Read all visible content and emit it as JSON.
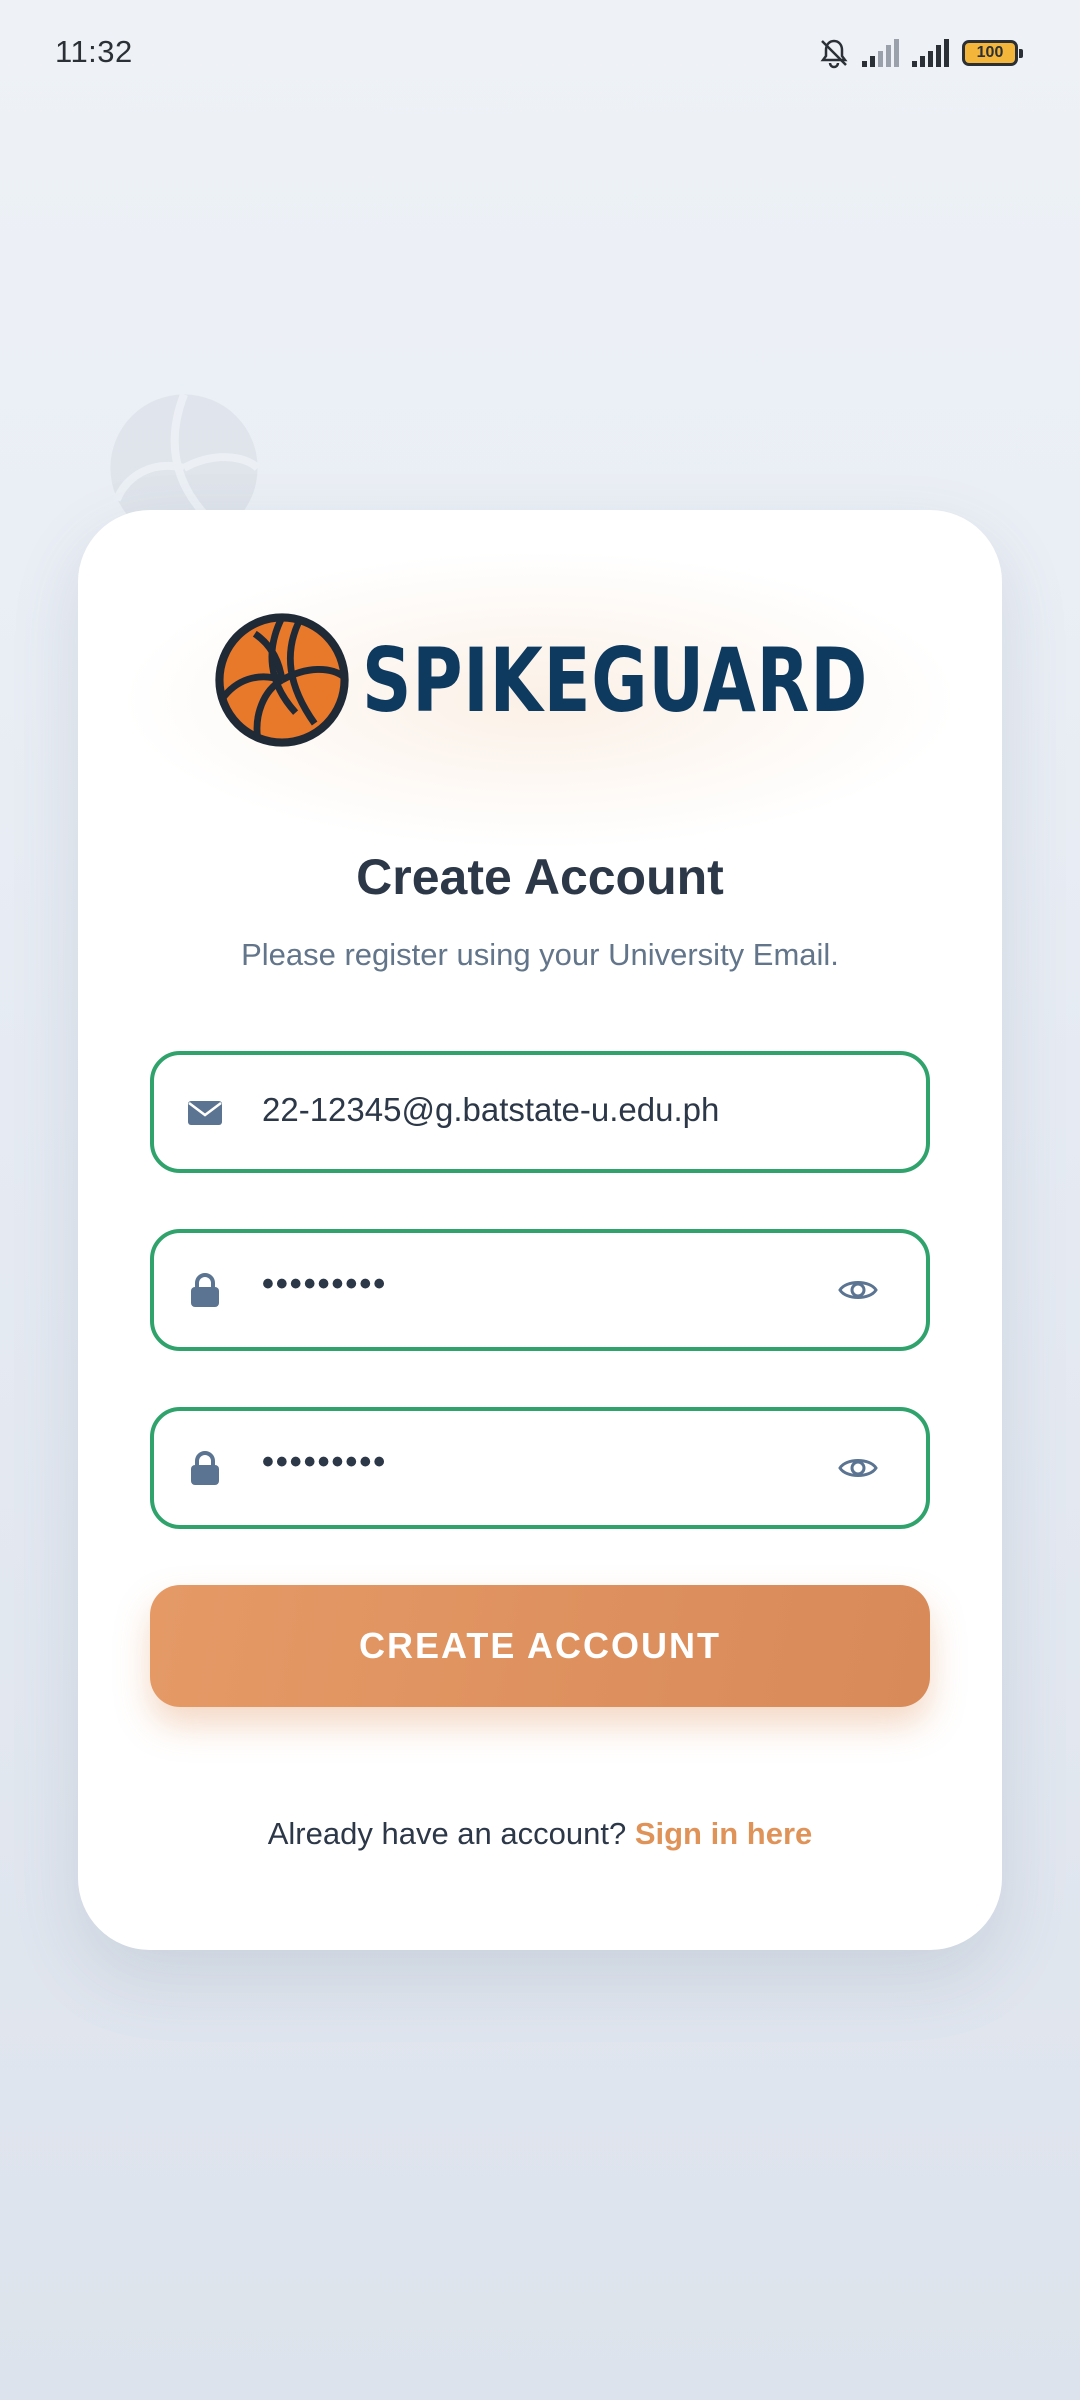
{
  "status_bar": {
    "time": "11:32",
    "battery": "100",
    "icons": [
      "bell-muted-icon",
      "signal-icon",
      "signal-icon",
      "battery-icon"
    ]
  },
  "logo": {
    "text": "SPIKEGUARD",
    "icon": "volleyball-icon",
    "colors": {
      "ball": "#e8782a",
      "text": "#0e3a5f"
    }
  },
  "form": {
    "title": "Create Account",
    "subtitle": "Please register using your University Email.",
    "email": {
      "icon": "envelope-icon",
      "value": "22-12345@g.batstate-u.edu.ph"
    },
    "password": {
      "icon": "lock-icon",
      "value": "•••••••••",
      "toggle_icon": "eye-icon"
    },
    "confirm_password": {
      "icon": "lock-icon",
      "value": "•••••••••",
      "toggle_icon": "eye-icon"
    },
    "submit_label": "CREATE ACCOUNT",
    "signin_prompt": "Already have an account?",
    "signin_link": "Sign in here"
  },
  "colors": {
    "accent": "#e09358",
    "field_border": "#2fa36b",
    "title": "#2c3748",
    "subtitle": "#62758a"
  }
}
